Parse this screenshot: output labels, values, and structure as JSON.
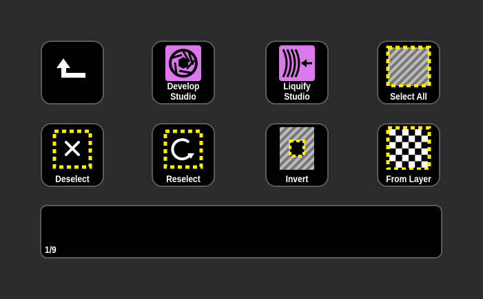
{
  "keys": [
    {
      "label_lines": [
        "",
        ""
      ],
      "icon": "back-arrow-icon"
    },
    {
      "label_lines": [
        "Develop",
        "Studio"
      ],
      "icon": "aperture-icon"
    },
    {
      "label_lines": [
        "Liquify",
        "Studio"
      ],
      "icon": "liquify-icon"
    },
    {
      "label_lines": [
        "",
        "Select All"
      ],
      "icon": "select-all-icon"
    },
    {
      "label_lines": [
        "",
        "Deselect"
      ],
      "icon": "deselect-icon"
    },
    {
      "label_lines": [
        "",
        "Reselect"
      ],
      "icon": "reselect-icon"
    },
    {
      "label_lines": [
        "",
        "Invert"
      ],
      "icon": "invert-selection-icon"
    },
    {
      "label_lines": [
        "",
        "From Layer"
      ],
      "icon": "from-layer-icon"
    }
  ],
  "touch_strip": {
    "page_indicator": "1/9"
  },
  "colors": {
    "background": "#2b2b2b",
    "key_bg": "#000000",
    "key_border": "#5a5a5a",
    "selection_yellow": "#ffee00",
    "studio_pink": "#dd77ee"
  }
}
